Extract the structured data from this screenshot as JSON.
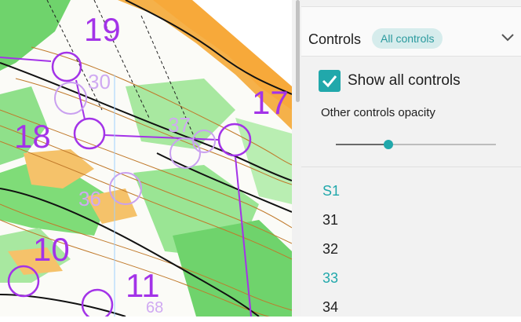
{
  "map": {
    "control_labels": [
      "19",
      "18",
      "17",
      "10",
      "11"
    ],
    "faint_labels": [
      "30",
      "36",
      "37",
      "68"
    ],
    "course_color": "#a333e8"
  },
  "panel": {
    "title": "Controls",
    "filter_chip": "All controls",
    "expand_icon": "chevron-down-icon",
    "show_all_label": "Show all controls",
    "show_all_checked": true,
    "opacity_label": "Other controls opacity",
    "opacity_value": 0.33,
    "accent_color": "#21a8ab",
    "controls": [
      {
        "label": "S1",
        "highlight": true
      },
      {
        "label": "31",
        "highlight": false
      },
      {
        "label": "32",
        "highlight": false
      },
      {
        "label": "33",
        "highlight": true
      },
      {
        "label": "34",
        "highlight": false
      }
    ]
  }
}
